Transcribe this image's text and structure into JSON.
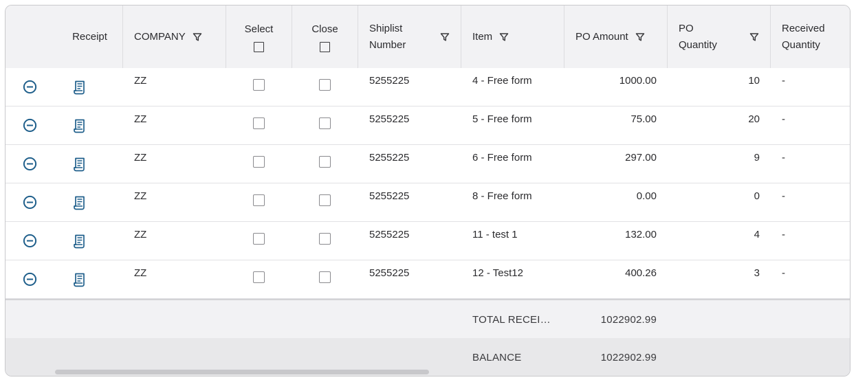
{
  "columns": {
    "receipt": "Receipt",
    "company": "COMPANY",
    "select": "Select",
    "close": "Close",
    "shiplist_line1": "Shiplist",
    "shiplist_line2": "Number",
    "item": "Item",
    "po_amount": "PO Amount",
    "po_quantity_line1": "PO",
    "po_quantity_line2": "Quantity",
    "received_line1": "Received",
    "received_line2": "Quantity"
  },
  "rows": [
    {
      "company": "ZZ",
      "shiplist": "5255225",
      "item": "4 - Free form",
      "po_amount": "1000.00",
      "po_quantity": "10",
      "received": "-"
    },
    {
      "company": "ZZ",
      "shiplist": "5255225",
      "item": "5 - Free form",
      "po_amount": "75.00",
      "po_quantity": "20",
      "received": "-"
    },
    {
      "company": "ZZ",
      "shiplist": "5255225",
      "item": "6 - Free form",
      "po_amount": "297.00",
      "po_quantity": "9",
      "received": "-"
    },
    {
      "company": "ZZ",
      "shiplist": "5255225",
      "item": "8 - Free form",
      "po_amount": "0.00",
      "po_quantity": "0",
      "received": "-"
    },
    {
      "company": "ZZ",
      "shiplist": "5255225",
      "item": "11 - test 1",
      "po_amount": "132.00",
      "po_quantity": "4",
      "received": "-"
    },
    {
      "company": "ZZ",
      "shiplist": "5255225",
      "item": "12 - Test12",
      "po_amount": "400.26",
      "po_quantity": "3",
      "received": "-"
    }
  ],
  "footer": {
    "total_label": "TOTAL RECEI…",
    "total_value": "1022902.99",
    "balance_label": "BALANCE",
    "balance_value": "1022902.99"
  },
  "icons": {
    "remove": "minus-circle-icon",
    "receipt": "receipt-icon",
    "filter": "filter-icon"
  },
  "colors": {
    "accent": "#1f5f8b"
  }
}
